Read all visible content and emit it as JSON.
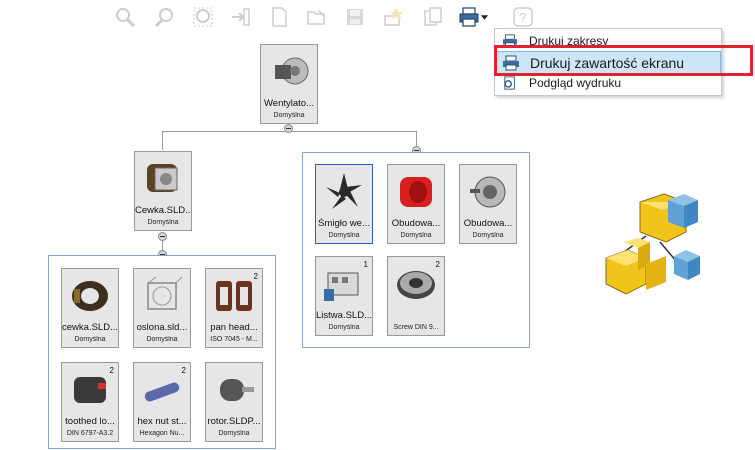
{
  "toolbar": {
    "buttons": [
      {
        "name": "zoom-fit-icon"
      },
      {
        "name": "zoom-in-out-icon"
      },
      {
        "name": "zoom-area-icon"
      },
      {
        "name": "import-icon"
      },
      {
        "name": "new-document-icon"
      },
      {
        "name": "open-folder-icon"
      },
      {
        "name": "save-icon"
      },
      {
        "name": "settings-icon"
      },
      {
        "name": "copy-icon"
      },
      {
        "name": "print-icon"
      },
      {
        "name": "help-icon"
      }
    ]
  },
  "print_menu": {
    "items": [
      {
        "label": "Drukuj zakresy"
      },
      {
        "label": "Drukuj zawartość ekranu"
      },
      {
        "label": "Podgląd wydruku"
      }
    ]
  },
  "tree": {
    "root": {
      "name": "Wentylato...",
      "config": "Domyślna"
    },
    "coil": {
      "name": "Cewka.SLD...",
      "config": "Domyślna"
    },
    "coil_children": [
      {
        "name": "cewka.SLD...",
        "config": "Domyślna",
        "count": ""
      },
      {
        "name": "oslona.sld...",
        "config": "Domyślna",
        "count": ""
      },
      {
        "name": "pan head...",
        "config": "ISO 7045 - M...",
        "count": "2"
      },
      {
        "name": "toothed lo...",
        "config": "DIN 6797-A3.2",
        "count": "2"
      },
      {
        "name": "hex nut st...",
        "config": "Hexagon Nu...",
        "count": "2"
      },
      {
        "name": "rotor.SLDP...",
        "config": "Domyślna",
        "count": ""
      }
    ],
    "right_group": [
      {
        "name": "Śmigło we...",
        "config": "Domyślna",
        "count": ""
      },
      {
        "name": "Obudowa...",
        "config": "Domyślna",
        "count": ""
      },
      {
        "name": "Obudowa...",
        "config": "Domyślna",
        "count": ""
      },
      {
        "name": "Listwa.SLD...",
        "config": "Domyślna",
        "count": "1"
      },
      {
        "name": "",
        "config": "Screw DIN 9...",
        "count": "2"
      }
    ]
  },
  "colors": {
    "accent": "#e0222f",
    "highlight": "#cde6f7",
    "group_border": "#8aa6c8"
  }
}
